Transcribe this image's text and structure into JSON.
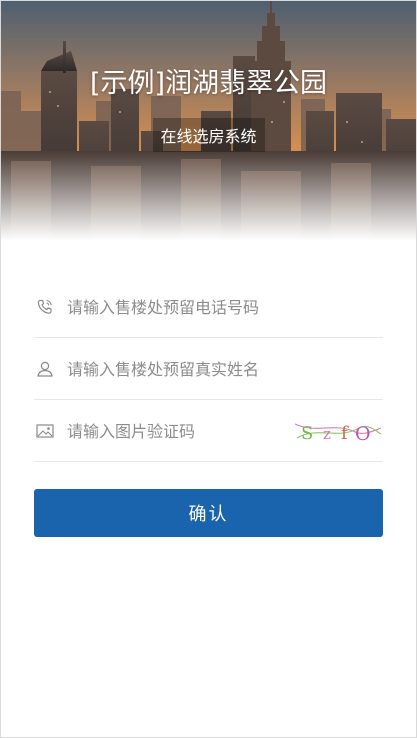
{
  "hero": {
    "title": "[示例]润湖翡翠公园",
    "subtitle": "在线选房系统"
  },
  "form": {
    "phone": {
      "placeholder": "请输入售楼处预留电话号码",
      "icon": "phone-icon"
    },
    "name": {
      "placeholder": "请输入售楼处预留真实姓名",
      "icon": "user-icon"
    },
    "captcha": {
      "placeholder": "请输入图片验证码",
      "icon": "image-icon",
      "code": "SzfO"
    }
  },
  "submit": {
    "label": "确认"
  },
  "colors": {
    "primary": "#1a63ad",
    "sky_top": "#5a6a7a",
    "sky_bottom": "#e08a3c"
  }
}
